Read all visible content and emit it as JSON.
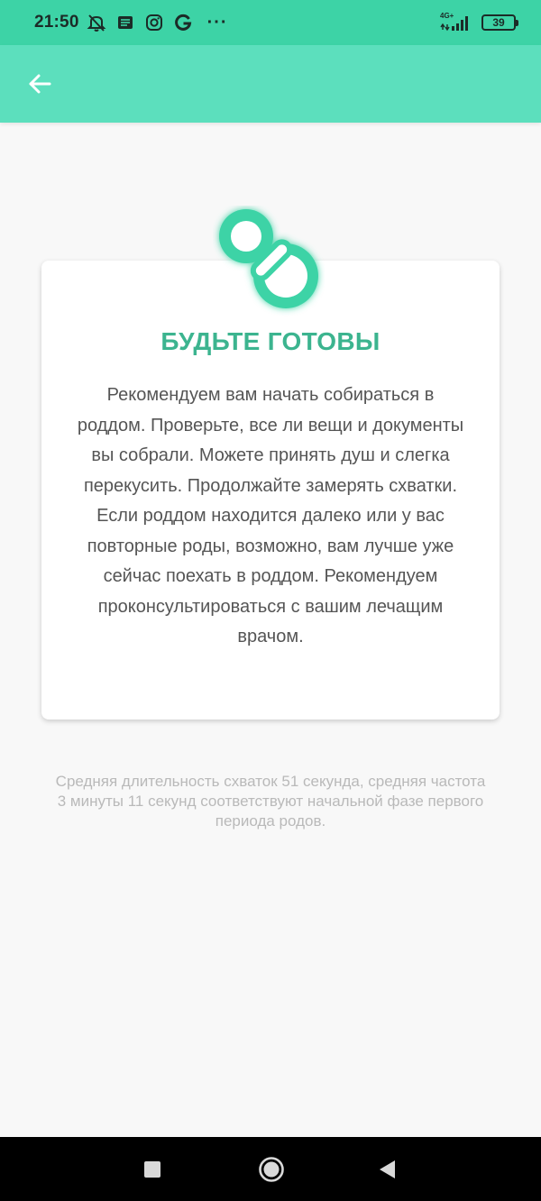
{
  "status_bar": {
    "time": "21:50",
    "icons": [
      "muted-alarm-icon",
      "notes-icon",
      "instagram-icon",
      "google-icon"
    ],
    "more": "···",
    "network_label": "4G+",
    "battery_level": "39",
    "background_color": "#3dd3a6"
  },
  "app_bar": {
    "back_icon": "arrow-left-icon",
    "background_color": "#5cdfbd"
  },
  "card": {
    "icon": "pacifier-icon",
    "title": "БУДЬТЕ ГОТОВЫ",
    "body": "Рекомендуем вам начать собираться в роддом. Проверьте, все ли вещи и документы вы собрали. Можете принять душ и слегка перекусить. Продолжайте замерять схватки. Если роддом находится далеко или у вас повторные роды, возможно, вам лучше уже сейчас поехать в роддом. Рекомендуем проконсультироваться с вашим лечащим врачом.",
    "accent_color": "#3cb48f"
  },
  "summary": {
    "text": "Средняя длительность схваток 51 секунда, средняя частота 3 минуты 11 секунд соответствуют начальной фазе первого периода родов."
  },
  "nav_bar": {
    "buttons": [
      "recents-square-icon",
      "home-circle-icon",
      "back-triangle-icon"
    ]
  }
}
